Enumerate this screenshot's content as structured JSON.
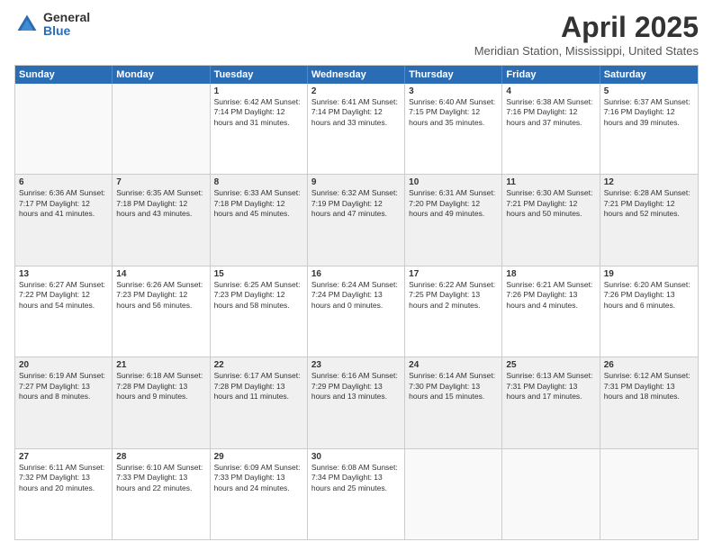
{
  "logo": {
    "general": "General",
    "blue": "Blue"
  },
  "title": "April 2025",
  "subtitle": "Meridian Station, Mississippi, United States",
  "days_of_week": [
    "Sunday",
    "Monday",
    "Tuesday",
    "Wednesday",
    "Thursday",
    "Friday",
    "Saturday"
  ],
  "weeks": [
    [
      {
        "day": "",
        "info": "",
        "empty": true
      },
      {
        "day": "",
        "info": "",
        "empty": true
      },
      {
        "day": "1",
        "info": "Sunrise: 6:42 AM\nSunset: 7:14 PM\nDaylight: 12 hours\nand 31 minutes."
      },
      {
        "day": "2",
        "info": "Sunrise: 6:41 AM\nSunset: 7:14 PM\nDaylight: 12 hours\nand 33 minutes."
      },
      {
        "day": "3",
        "info": "Sunrise: 6:40 AM\nSunset: 7:15 PM\nDaylight: 12 hours\nand 35 minutes."
      },
      {
        "day": "4",
        "info": "Sunrise: 6:38 AM\nSunset: 7:16 PM\nDaylight: 12 hours\nand 37 minutes."
      },
      {
        "day": "5",
        "info": "Sunrise: 6:37 AM\nSunset: 7:16 PM\nDaylight: 12 hours\nand 39 minutes."
      }
    ],
    [
      {
        "day": "6",
        "info": "Sunrise: 6:36 AM\nSunset: 7:17 PM\nDaylight: 12 hours\nand 41 minutes.",
        "shaded": true
      },
      {
        "day": "7",
        "info": "Sunrise: 6:35 AM\nSunset: 7:18 PM\nDaylight: 12 hours\nand 43 minutes.",
        "shaded": true
      },
      {
        "day": "8",
        "info": "Sunrise: 6:33 AM\nSunset: 7:18 PM\nDaylight: 12 hours\nand 45 minutes.",
        "shaded": true
      },
      {
        "day": "9",
        "info": "Sunrise: 6:32 AM\nSunset: 7:19 PM\nDaylight: 12 hours\nand 47 minutes.",
        "shaded": true
      },
      {
        "day": "10",
        "info": "Sunrise: 6:31 AM\nSunset: 7:20 PM\nDaylight: 12 hours\nand 49 minutes.",
        "shaded": true
      },
      {
        "day": "11",
        "info": "Sunrise: 6:30 AM\nSunset: 7:21 PM\nDaylight: 12 hours\nand 50 minutes.",
        "shaded": true
      },
      {
        "day": "12",
        "info": "Sunrise: 6:28 AM\nSunset: 7:21 PM\nDaylight: 12 hours\nand 52 minutes.",
        "shaded": true
      }
    ],
    [
      {
        "day": "13",
        "info": "Sunrise: 6:27 AM\nSunset: 7:22 PM\nDaylight: 12 hours\nand 54 minutes."
      },
      {
        "day": "14",
        "info": "Sunrise: 6:26 AM\nSunset: 7:23 PM\nDaylight: 12 hours\nand 56 minutes."
      },
      {
        "day": "15",
        "info": "Sunrise: 6:25 AM\nSunset: 7:23 PM\nDaylight: 12 hours\nand 58 minutes."
      },
      {
        "day": "16",
        "info": "Sunrise: 6:24 AM\nSunset: 7:24 PM\nDaylight: 13 hours\nand 0 minutes."
      },
      {
        "day": "17",
        "info": "Sunrise: 6:22 AM\nSunset: 7:25 PM\nDaylight: 13 hours\nand 2 minutes."
      },
      {
        "day": "18",
        "info": "Sunrise: 6:21 AM\nSunset: 7:26 PM\nDaylight: 13 hours\nand 4 minutes."
      },
      {
        "day": "19",
        "info": "Sunrise: 6:20 AM\nSunset: 7:26 PM\nDaylight: 13 hours\nand 6 minutes."
      }
    ],
    [
      {
        "day": "20",
        "info": "Sunrise: 6:19 AM\nSunset: 7:27 PM\nDaylight: 13 hours\nand 8 minutes.",
        "shaded": true
      },
      {
        "day": "21",
        "info": "Sunrise: 6:18 AM\nSunset: 7:28 PM\nDaylight: 13 hours\nand 9 minutes.",
        "shaded": true
      },
      {
        "day": "22",
        "info": "Sunrise: 6:17 AM\nSunset: 7:28 PM\nDaylight: 13 hours\nand 11 minutes.",
        "shaded": true
      },
      {
        "day": "23",
        "info": "Sunrise: 6:16 AM\nSunset: 7:29 PM\nDaylight: 13 hours\nand 13 minutes.",
        "shaded": true
      },
      {
        "day": "24",
        "info": "Sunrise: 6:14 AM\nSunset: 7:30 PM\nDaylight: 13 hours\nand 15 minutes.",
        "shaded": true
      },
      {
        "day": "25",
        "info": "Sunrise: 6:13 AM\nSunset: 7:31 PM\nDaylight: 13 hours\nand 17 minutes.",
        "shaded": true
      },
      {
        "day": "26",
        "info": "Sunrise: 6:12 AM\nSunset: 7:31 PM\nDaylight: 13 hours\nand 18 minutes.",
        "shaded": true
      }
    ],
    [
      {
        "day": "27",
        "info": "Sunrise: 6:11 AM\nSunset: 7:32 PM\nDaylight: 13 hours\nand 20 minutes."
      },
      {
        "day": "28",
        "info": "Sunrise: 6:10 AM\nSunset: 7:33 PM\nDaylight: 13 hours\nand 22 minutes."
      },
      {
        "day": "29",
        "info": "Sunrise: 6:09 AM\nSunset: 7:33 PM\nDaylight: 13 hours\nand 24 minutes."
      },
      {
        "day": "30",
        "info": "Sunrise: 6:08 AM\nSunset: 7:34 PM\nDaylight: 13 hours\nand 25 minutes."
      },
      {
        "day": "",
        "info": "",
        "empty": true
      },
      {
        "day": "",
        "info": "",
        "empty": true
      },
      {
        "day": "",
        "info": "",
        "empty": true
      }
    ]
  ]
}
